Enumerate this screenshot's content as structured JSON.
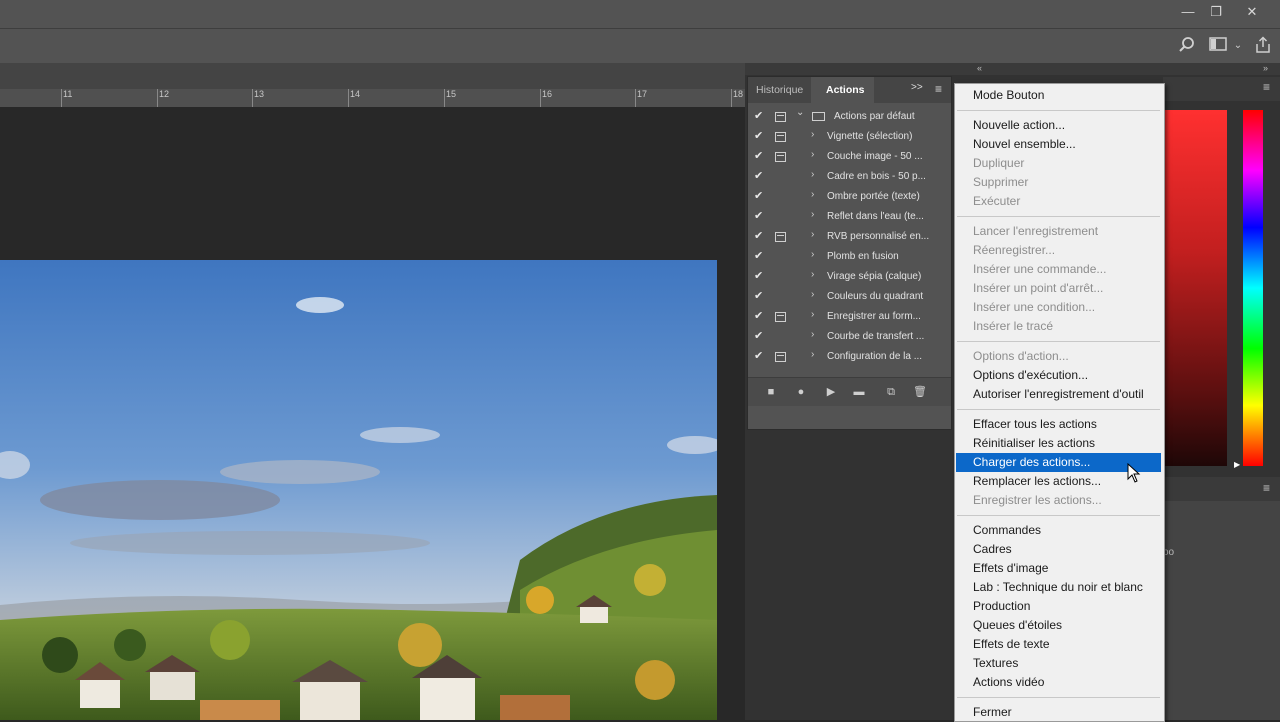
{
  "window": {
    "minimize_glyph": "—",
    "restore_glyph": "❐",
    "close_glyph": "✕"
  },
  "options_bar": {
    "icons": [
      "search-icon",
      "workspace-icon",
      "chevron-down-icon",
      "share-icon"
    ]
  },
  "ruler": {
    "ticks": [
      "11",
      "12",
      "13",
      "14",
      "15",
      "16",
      "17",
      "18"
    ]
  },
  "actions_panel": {
    "tabs": {
      "history": "Historique",
      "actions": "Actions"
    },
    "expand_glyph": ">>",
    "menu_glyph": "≡",
    "rows": [
      {
        "label": "Actions par défaut",
        "dialog": true,
        "set": true
      },
      {
        "label": "Vignette (sélection)",
        "dialog": true
      },
      {
        "label": "Couche image - 50 ...",
        "dialog": true
      },
      {
        "label": "Cadre en bois - 50 p...",
        "dialog": false
      },
      {
        "label": "Ombre portée (texte)",
        "dialog": false
      },
      {
        "label": "Reflet dans l'eau (te...",
        "dialog": false
      },
      {
        "label": "RVB personnalisé en...",
        "dialog": true
      },
      {
        "label": "Plomb en fusion",
        "dialog": false
      },
      {
        "label": "Virage sépia (calque)",
        "dialog": false
      },
      {
        "label": "Couleurs du quadrant",
        "dialog": false
      },
      {
        "label": "Enregistrer au form...",
        "dialog": true
      },
      {
        "label": "Courbe de transfert ...",
        "dialog": false
      },
      {
        "label": "Configuration de la ...",
        "dialog": true
      }
    ],
    "bottom_icons": [
      "stop-icon",
      "record-icon",
      "play-icon",
      "folder-icon",
      "new-action-icon",
      "trash-icon"
    ]
  },
  "menu": {
    "items": [
      {
        "label": "Mode Bouton",
        "disabled": false
      },
      {
        "sep": true
      },
      {
        "label": "Nouvelle action...",
        "disabled": false
      },
      {
        "label": "Nouvel ensemble...",
        "disabled": false
      },
      {
        "label": "Dupliquer",
        "disabled": true
      },
      {
        "label": "Supprimer",
        "disabled": true
      },
      {
        "label": "Exécuter",
        "disabled": true
      },
      {
        "sep": true
      },
      {
        "label": "Lancer l'enregistrement",
        "disabled": true
      },
      {
        "label": "Réenregistrer...",
        "disabled": true
      },
      {
        "label": "Insérer une commande...",
        "disabled": true
      },
      {
        "label": "Insérer un point d'arrêt...",
        "disabled": true
      },
      {
        "label": "Insérer une condition...",
        "disabled": true
      },
      {
        "label": "Insérer le tracé",
        "disabled": true
      },
      {
        "sep": true
      },
      {
        "label": "Options d'action...",
        "disabled": true
      },
      {
        "label": "Options d'exécution...",
        "disabled": false
      },
      {
        "label": "Autoriser l'enregistrement d'outil",
        "disabled": false
      },
      {
        "sep": true
      },
      {
        "label": "Effacer tous les actions",
        "disabled": false
      },
      {
        "label": "Réinitialiser les actions",
        "disabled": false
      },
      {
        "label": "Charger des actions...",
        "disabled": false,
        "highlighted": true
      },
      {
        "label": "Remplacer les actions...",
        "disabled": false
      },
      {
        "label": "Enregistrer les actions...",
        "disabled": true
      },
      {
        "sep": true
      },
      {
        "label": "Commandes",
        "disabled": false
      },
      {
        "label": "Cadres",
        "disabled": false
      },
      {
        "label": "Effets d'image",
        "disabled": false
      },
      {
        "label": "Lab : Technique du noir et blanc",
        "disabled": false
      },
      {
        "label": "Production",
        "disabled": false
      },
      {
        "label": "Queues d'étoiles",
        "disabled": false
      },
      {
        "label": "Effets de texte",
        "disabled": false
      },
      {
        "label": "Textures",
        "disabled": false
      },
      {
        "label": "Actions vidéo",
        "disabled": false
      },
      {
        "sep": true
      },
      {
        "label": "Fermer",
        "disabled": false
      }
    ]
  },
  "colors": {
    "highlight": "#0c68c9",
    "menu_bg": "#f0f0f0",
    "panel_bg": "#535353",
    "app_bg": "#282828"
  },
  "right_panel": {
    "partial_text": "oo"
  }
}
